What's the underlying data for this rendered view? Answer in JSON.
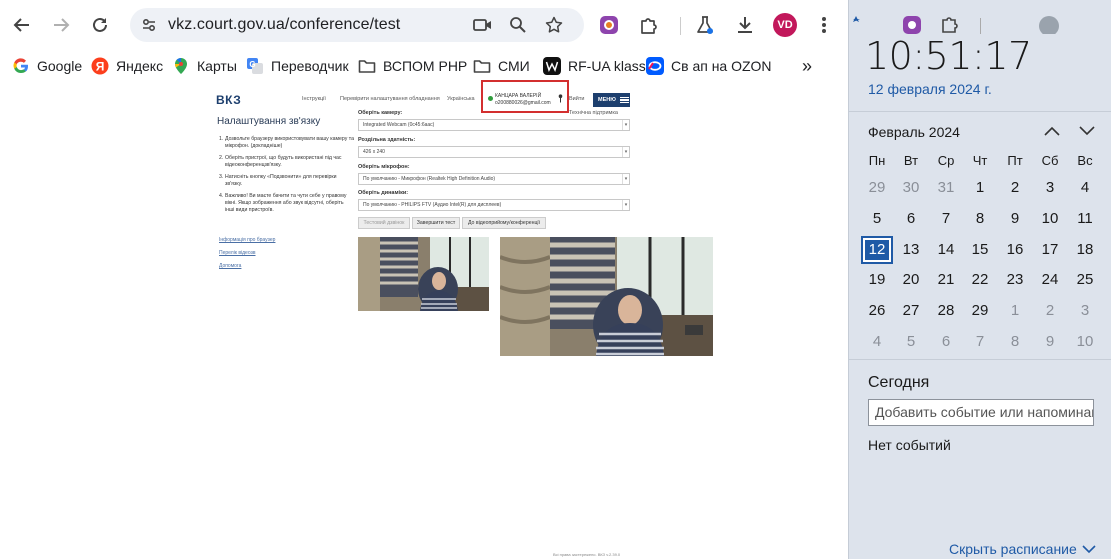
{
  "browser": {
    "url": "vkz.court.gov.ua/conference/test",
    "avatar_initials": "VD",
    "bookmarks": [
      {
        "label": "Google",
        "icon": "google-icon"
      },
      {
        "label": "Яндекс",
        "icon": "yandex-icon"
      },
      {
        "label": "Карты",
        "icon": "maps-pin-icon"
      },
      {
        "label": "Переводчик",
        "icon": "translate-icon"
      },
      {
        "label": "ВСПОМ PHP",
        "icon": "folder-icon"
      },
      {
        "label": "СМИ",
        "icon": "folder-icon"
      },
      {
        "label": "RF-UA klass",
        "icon": "w-logo-icon"
      },
      {
        "label": "Св ап на OZON",
        "icon": "ozon-icon"
      }
    ],
    "more_bookmarks": "»"
  },
  "site": {
    "logo": "ВКЗ",
    "header_links": [
      "Інструкції",
      "Перевірити налаштування обладнання",
      "Українська"
    ],
    "user_name": "КАНЦАРА ВАЛЕРІЙ",
    "user_email": "o200880026@gmail.com",
    "exit": "Вийти",
    "menu": "МЕНЮ",
    "tech_support": "Технічна підтримка",
    "setup_title": "Налаштування зв'язку",
    "steps": [
      {
        "num": "1.",
        "text": "Дозвольте браузеру використовувати вашу камеру та мікрофон. (докладніше)"
      },
      {
        "num": "2.",
        "text": "Оберіть пристрої, що будуть використані під час відеоконференцзв'язку."
      },
      {
        "num": "3.",
        "text": "Натисніть кнопку «Подзвонити» для перевірки зв'язку."
      },
      {
        "num": "4.",
        "text": "Важливо! Ви маєте бачити та чути себе у правому вікні. Якщо зображення або звук відсутні, оберіть інші види пристроїв."
      }
    ],
    "side_links": [
      "Інформація про браузер",
      "Перелік відеозв",
      "Допомога"
    ],
    "camera_label": "Оберіть камеру:",
    "camera_value": "Integrated Webcam (0c45:6aac)",
    "resolution_label": "Роздільна здатність:",
    "resolution_value": "426 x 240",
    "mic_label": "Оберіть мікрофон:",
    "mic_value": "По умолчанию - Микрофон (Realtek High Definition Audio)",
    "speaker_label": "Оберіть динаміки:",
    "speaker_value": "По умолчанию - PHILIPS FTV (Аудио Intel(R) для дисплеев)",
    "buttons": [
      "Тестовий дзвінок",
      "Завершити тест",
      "До відеоприйому/конференції"
    ],
    "footer": "Всі права застережено. ВКЗ v.2.39.0"
  },
  "calendar": {
    "time": "10:51:17",
    "date": "12 февраля 2024 г.",
    "month": "Февраль 2024",
    "weekdays": [
      "Пн",
      "Вт",
      "Ср",
      "Чт",
      "Пт",
      "Сб",
      "Вс"
    ],
    "days": [
      "29",
      "30",
      "31",
      "1",
      "2",
      "3",
      "4",
      "5",
      "6",
      "7",
      "8",
      "9",
      "10",
      "11",
      "12",
      "13",
      "14",
      "15",
      "16",
      "17",
      "18",
      "19",
      "20",
      "21",
      "22",
      "23",
      "24",
      "25",
      "26",
      "27",
      "28",
      "29",
      "1",
      "2",
      "3",
      "4",
      "5",
      "6",
      "7",
      "8",
      "9",
      "10"
    ],
    "today_label": "Сегодня",
    "event_placeholder": "Добавить событие или напоминание",
    "no_events": "Нет событий",
    "schedule_link": "Скрыть расписание",
    "accent": "#1f5aa6"
  }
}
